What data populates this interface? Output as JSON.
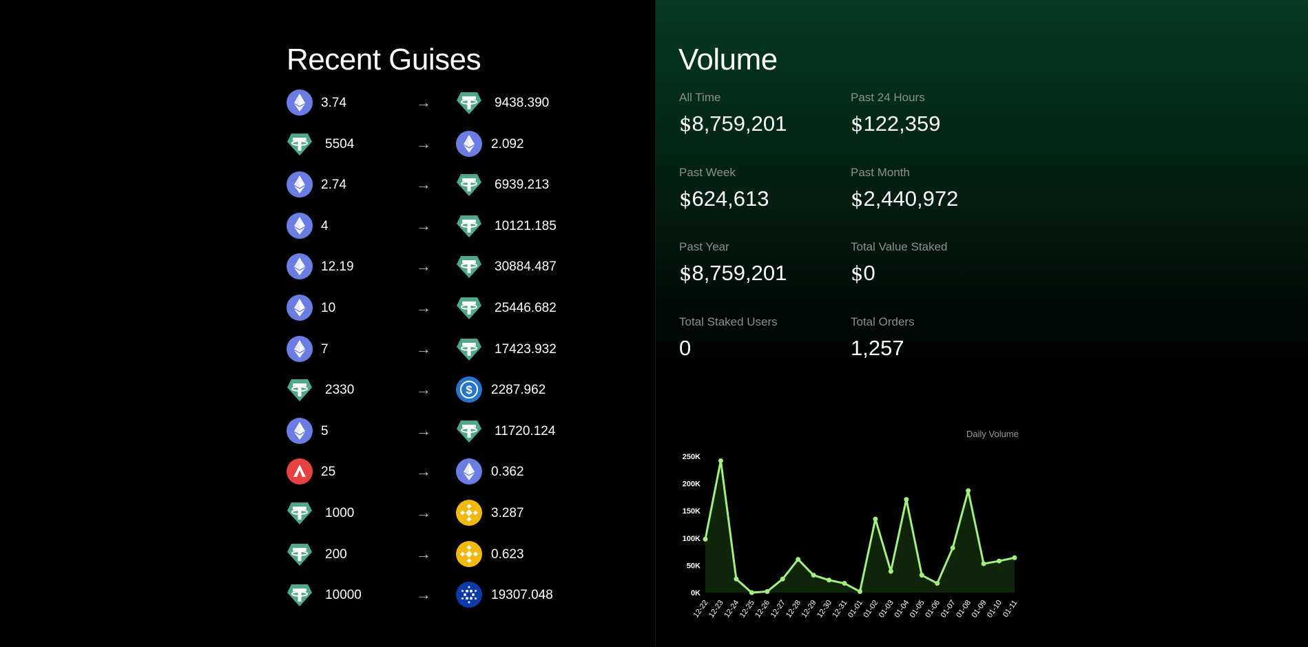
{
  "recent": {
    "title": "Recent Guises",
    "arrow": "→",
    "swaps": [
      {
        "from_icon": "eth-icon",
        "from": "3.74",
        "to_icon": "usdt-icon",
        "to": "9438.390"
      },
      {
        "from_icon": "usdt-icon",
        "from": "5504",
        "to_icon": "eth-icon",
        "to": "2.092"
      },
      {
        "from_icon": "eth-icon",
        "from": "2.74",
        "to_icon": "usdt-icon",
        "to": "6939.213"
      },
      {
        "from_icon": "eth-icon",
        "from": "4",
        "to_icon": "usdt-icon",
        "to": "10121.185"
      },
      {
        "from_icon": "eth-icon",
        "from": "12.19",
        "to_icon": "usdt-icon",
        "to": "30884.487"
      },
      {
        "from_icon": "eth-icon",
        "from": "10",
        "to_icon": "usdt-icon",
        "to": "25446.682"
      },
      {
        "from_icon": "eth-icon",
        "from": "7",
        "to_icon": "usdt-icon",
        "to": "17423.932"
      },
      {
        "from_icon": "usdt-icon",
        "from": "2330",
        "to_icon": "usdc-icon",
        "to": "2287.962"
      },
      {
        "from_icon": "eth-icon",
        "from": "5",
        "to_icon": "usdt-icon",
        "to": "11720.124"
      },
      {
        "from_icon": "avax-icon",
        "from": "25",
        "to_icon": "eth-icon",
        "to": "0.362"
      },
      {
        "from_icon": "usdt-icon",
        "from": "1000",
        "to_icon": "bnb-icon",
        "to": "3.287"
      },
      {
        "from_icon": "usdt-icon",
        "from": "200",
        "to_icon": "bnb-icon",
        "to": "0.623"
      },
      {
        "from_icon": "usdt-icon",
        "from": "10000",
        "to_icon": "ada-icon",
        "to": "19307.048"
      }
    ]
  },
  "volume": {
    "title": "Volume",
    "stats": [
      {
        "label": "All Time",
        "currency": "$",
        "value": "8,759,201"
      },
      {
        "label": "Past 24 Hours",
        "currency": "$",
        "value": "122,359"
      },
      {
        "label": "Past Week",
        "currency": "$",
        "value": "624,613"
      },
      {
        "label": "Past Month",
        "currency": "$",
        "value": "2,440,972"
      },
      {
        "label": "Past Year",
        "currency": "$",
        "value": "8,759,201"
      },
      {
        "label": "Total Value Staked",
        "currency": "$",
        "value": "0"
      },
      {
        "label": "Total Staked Users",
        "currency": "",
        "value": "0"
      },
      {
        "label": "Total Orders",
        "currency": "",
        "value": "1,257"
      }
    ]
  },
  "chart_data": {
    "type": "area",
    "title": "Daily Volume",
    "x": [
      "12-22",
      "12-23",
      "12-24",
      "12-25",
      "12-26",
      "12-27",
      "12-28",
      "12-29",
      "12-30",
      "12-31",
      "01-01",
      "01-02",
      "01-03",
      "01-04",
      "01-05",
      "01-06",
      "01-07",
      "01-08",
      "01-09",
      "01-10",
      "01-11"
    ],
    "series": [
      {
        "values": [
          98000,
          242000,
          25000,
          0,
          2000,
          25000,
          61000,
          32000,
          23000,
          17000,
          2000,
          135000,
          39000,
          171000,
          32000,
          17000,
          82000,
          187000,
          53000,
          58000,
          64000
        ]
      }
    ],
    "yticks": [
      "250K",
      "200K",
      "150K",
      "100K",
      "50K",
      "0K"
    ],
    "ylim": [
      0,
      250000
    ],
    "line_color": "#a3f07e",
    "fill_color": "#0f2409",
    "grid": false
  },
  "colors": {
    "eth": "#6b7de3",
    "usdt": "#4ea98c",
    "usdc": "#2775ca",
    "avax": "#e84142",
    "bnb": "#f0b90b",
    "ada": "#0d3aa8"
  }
}
